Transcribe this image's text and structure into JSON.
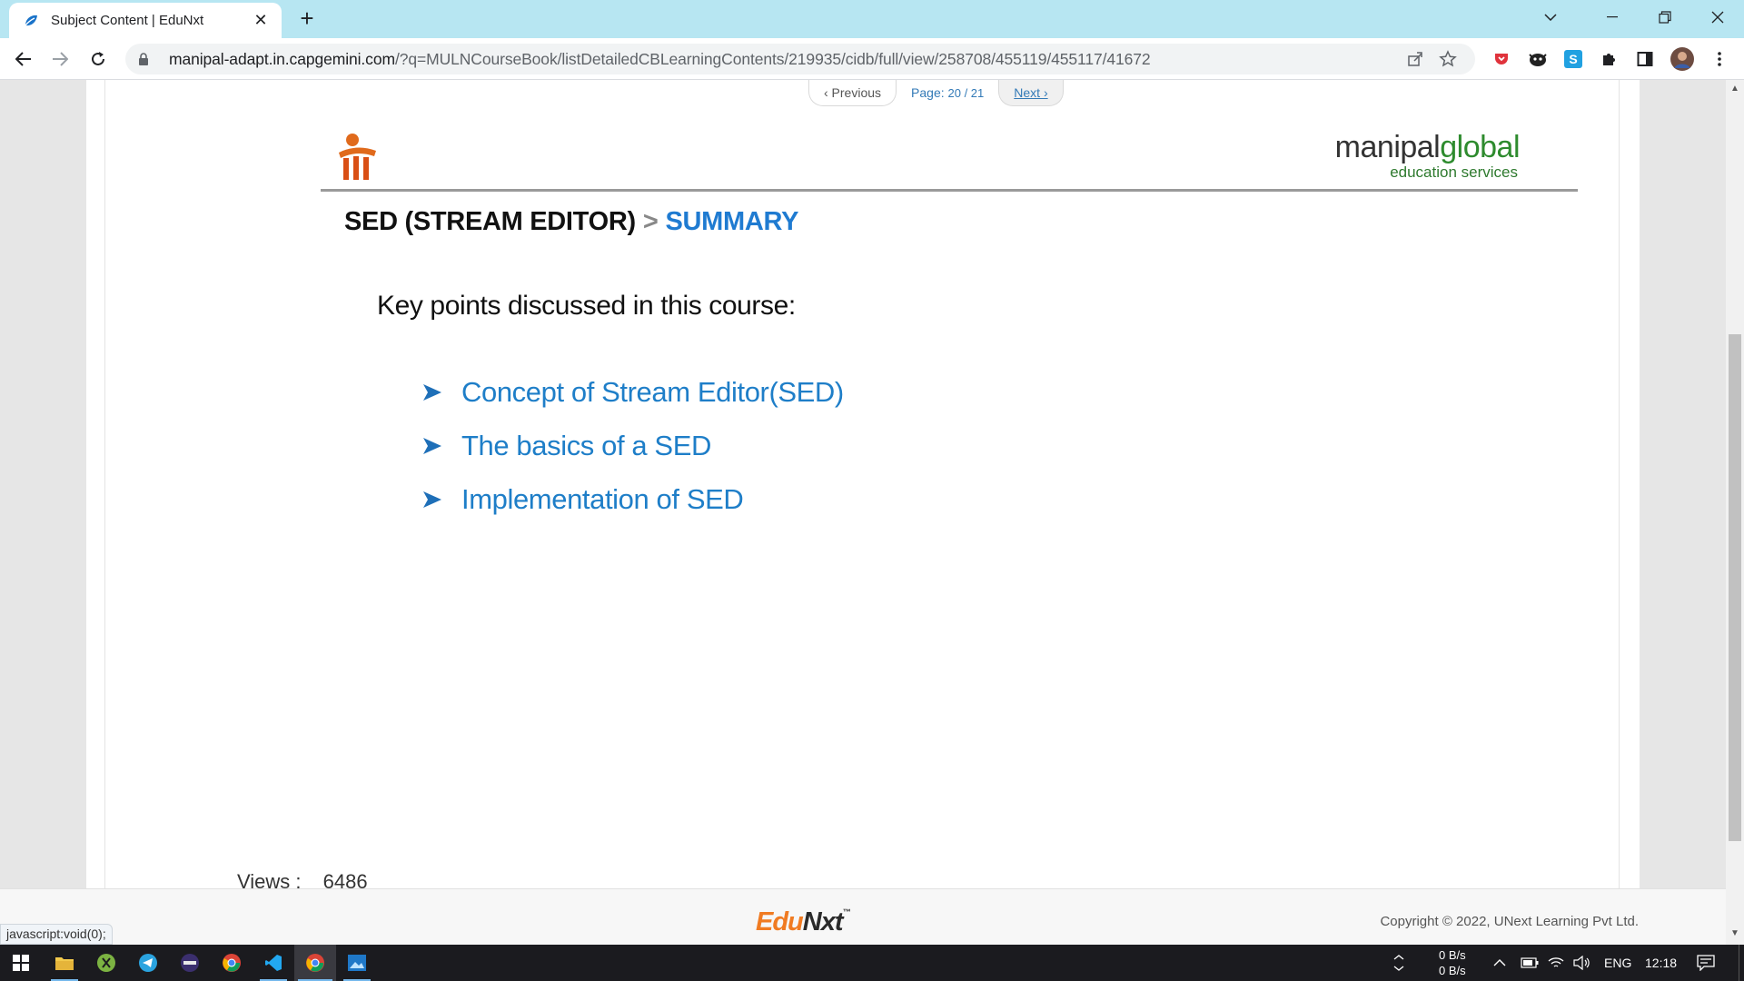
{
  "browser": {
    "tab_title": "Subject Content | EduNxt",
    "url_host": "manipal-adapt.in.capgemini.com",
    "url_path": "/?q=MULNCourseBook/listDetailedCBLearningContents/219935/cidb/full/view/258708/455119/455117/41672"
  },
  "pager": {
    "prev_label": "‹ Previous",
    "page_label": "Page:",
    "page_value": "20 / 21",
    "next_label": "Next ›"
  },
  "slide": {
    "brand_part1": "manipal",
    "brand_part2": "global",
    "brand_sub": "education services",
    "heading_main": "SED (STREAM EDITOR)",
    "heading_sep": ">",
    "heading_sub": "SUMMARY",
    "intro": "Key points discussed in this course:",
    "points": [
      "Concept of Stream Editor(SED)",
      "The basics of a SED",
      "Implementation of SED"
    ]
  },
  "views": {
    "label": "Views :",
    "value": "6486"
  },
  "footer": {
    "logo_part1": "Edu",
    "logo_part2": "Nxt",
    "copyright": "Copyright © 2022, UNext Learning Pvt Ltd.",
    "status_url": "javascript:void(0);"
  },
  "taskbar": {
    "net_up": "0 B/s",
    "net_down": "0 B/s",
    "language": "ENG",
    "time": "12:18"
  },
  "colors": {
    "tabstrip": "#b7e6f2",
    "heading_blue": "#1f7bd1",
    "point_blue": "#1e7ec8",
    "brand_green": "#2e8b2e",
    "edunxt_orange": "#f07b22"
  }
}
